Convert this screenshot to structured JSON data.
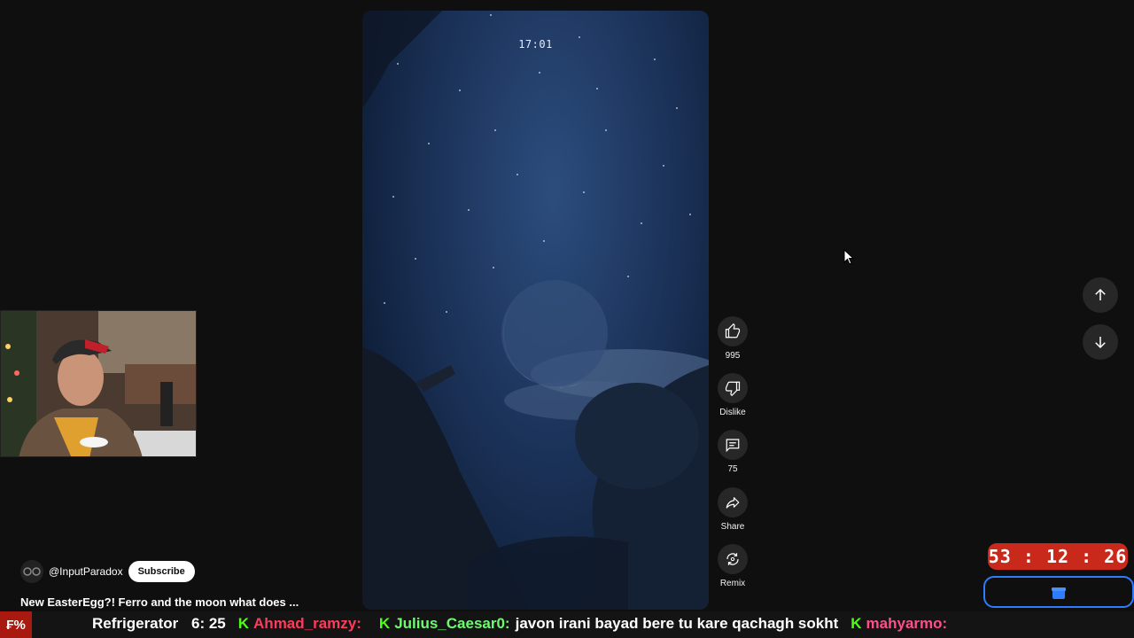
{
  "video": {
    "timestamp": "17:01"
  },
  "actions": [
    {
      "icon": "thumbs-up-icon",
      "label": "995"
    },
    {
      "icon": "thumbs-down-icon",
      "label": "Dislike"
    },
    {
      "icon": "comment-icon",
      "label": "75"
    },
    {
      "icon": "share-icon",
      "label": "Share"
    },
    {
      "icon": "remix-icon",
      "label": "Remix"
    }
  ],
  "channel": {
    "handle": "@InputParadox",
    "subscribe_label": "Subscribe"
  },
  "video_title": "New EasterEgg?! Ferro and the moon what does ...",
  "ticker": {
    "left_badge": "₣%",
    "song": "Refrigerator",
    "partial": "6: 25",
    "messages": [
      {
        "user": "Ahmad_ramzy:",
        "text": ""
      },
      {
        "user": "Julius_Caesar0:",
        "text": "javon irani bayad bere tu kare qachagh sokht"
      },
      {
        "user": "mahyarmo:",
        "text": ""
      }
    ]
  },
  "timer": {
    "value": "53 : 12 : 26"
  },
  "colors": {
    "background": "#0f0f0f",
    "accent_red": "#c8291a",
    "kick_green": "#53fc18",
    "timer_outline": "#2f7dff"
  }
}
